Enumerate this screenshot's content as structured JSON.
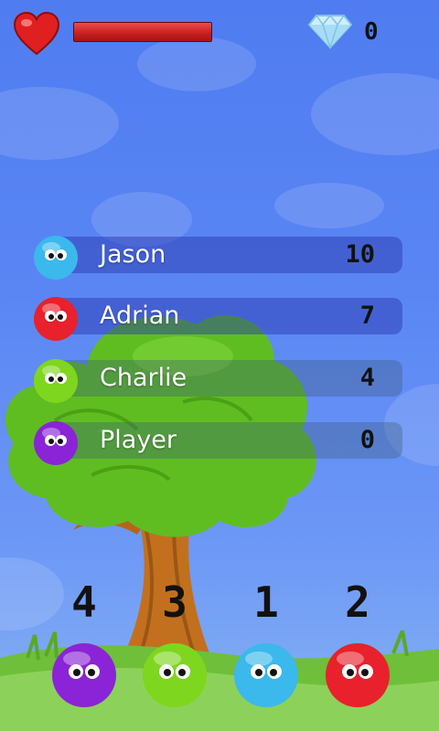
{
  "hud": {
    "heart_icon": "heart-icon",
    "health_fraction": 1.0,
    "gem_icon": "diamond-icon",
    "gem_count": "0"
  },
  "scoreboard": [
    {
      "name": "Jason",
      "score": "10",
      "color": "#3bb8ec"
    },
    {
      "name": "Adrian",
      "score": "7",
      "color": "#e8212c"
    },
    {
      "name": "Charlie",
      "score": "4",
      "color": "#7fd61e"
    },
    {
      "name": "Player",
      "score": "0",
      "color": "#8a24d6"
    }
  ],
  "ball_counts": [
    {
      "count": "4",
      "color": "#8a24d6"
    },
    {
      "count": "3",
      "color": "#7fd61e"
    },
    {
      "count": "1",
      "color": "#3bb8ec"
    },
    {
      "count": "2",
      "color": "#e8212c"
    }
  ]
}
